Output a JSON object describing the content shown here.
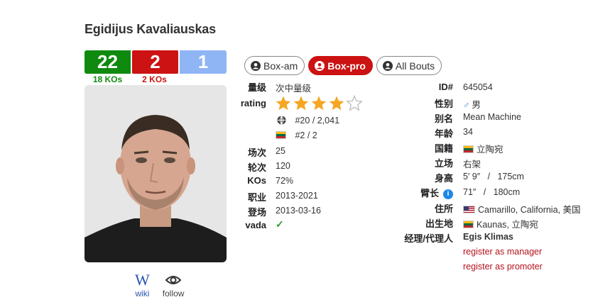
{
  "boxer": {
    "name": "Egidijus Kavaliauskas",
    "wins": "22",
    "losses": "2",
    "draws": "1",
    "win_kos": "18 KOs",
    "loss_kos": "2 KOs"
  },
  "links": {
    "wiki": "wiki",
    "follow": "follow"
  },
  "tabs": [
    {
      "label": "Box-am",
      "active": false
    },
    {
      "label": "Box-pro",
      "active": true
    },
    {
      "label": "All Bouts",
      "active": false
    }
  ],
  "left_table": {
    "division_label": "量级",
    "division": "次中量级",
    "rating_label": "rating",
    "rating_stars": 4,
    "rating_max": 5,
    "world_rank": "#20 / 2,041",
    "national_rank": "#2 / 2",
    "bouts_label": "场次",
    "bouts": "25",
    "rounds_label": "轮次",
    "rounds": "120",
    "kos_label": "KOs",
    "kos": "72%",
    "career_label": "职业",
    "career": "2013-2021",
    "debut_label": "登场",
    "debut": "2013-03-16",
    "vada_label": "vada",
    "vada": "✓"
  },
  "right_table": {
    "id_label": "ID#",
    "id": "645054",
    "sex_label": "性别",
    "sex": "男",
    "alias_label": "别名",
    "alias": "Mean Machine",
    "age_label": "年龄",
    "age": "34",
    "nationality_label": "国籍",
    "nationality": "立陶宛",
    "stance_label": "立场",
    "stance": "右架",
    "height_label": "身高",
    "height": "5′ 9″   /   175cm",
    "reach_label": "臂长",
    "reach": "71″   /   180cm",
    "residence_label": "住所",
    "residence": "Camarillo, California, 美国",
    "birthplace_label": "出生地",
    "birthplace": "Kaunas, 立陶宛",
    "manager_label": "经理/代理人",
    "manager": "Egis Klimas",
    "register_manager": "register as manager",
    "register_promoter": "register as promoter"
  },
  "colors": {
    "win": "#0f8a0f",
    "loss": "#cc1212",
    "draw": "#8fb5f5",
    "star": "#f5a623"
  }
}
